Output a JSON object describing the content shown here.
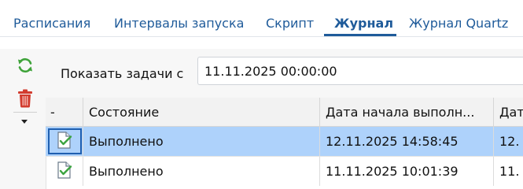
{
  "tabs": [
    {
      "label": "Расписания",
      "active": false
    },
    {
      "label": "Интервалы запуска",
      "active": false
    },
    {
      "label": "Скрипт",
      "active": false
    },
    {
      "label": "Журнал",
      "active": true
    },
    {
      "label": "Журнал Quartz",
      "active": false
    }
  ],
  "toolbar": {
    "refresh_icon": "refresh-icon",
    "delete_icon": "trash-icon",
    "more_icon": "chevron-down-icon",
    "accent": "#3fa33a",
    "delete_color": "#d23b2e"
  },
  "filter": {
    "label": "Показать задачи с",
    "value": "11.11.2025 00:00:00"
  },
  "table": {
    "columns": [
      "-",
      "Состояние",
      "Дата начала выполн...",
      "Дат"
    ],
    "rows": [
      {
        "icon": "document-check-icon",
        "status": "Выполнено",
        "start": "12.11.2025 14:58:45",
        "next": "12.",
        "selected": true
      },
      {
        "icon": "document-check-icon",
        "status": "Выполнено",
        "start": "11.11.2025 10:01:39",
        "next": "11.",
        "selected": false
      }
    ]
  }
}
